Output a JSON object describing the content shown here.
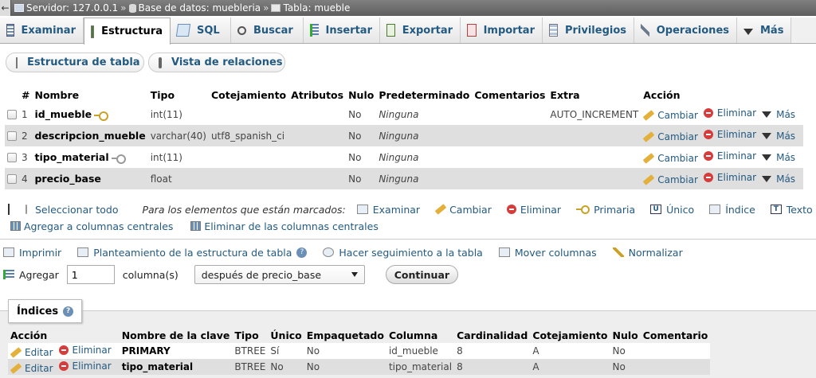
{
  "breadcrumb": {
    "back": "←",
    "server": "Servidor: 127.0.0.1",
    "database": "Base de datos: muebleria",
    "table": "Tabla: mueble",
    "sep": "»"
  },
  "tabs": [
    {
      "label": "Examinar",
      "icon": "browse-icon"
    },
    {
      "label": "Estructura",
      "icon": "structure-icon"
    },
    {
      "label": "SQL",
      "icon": "sql-icon"
    },
    {
      "label": "Buscar",
      "icon": "search-icon"
    },
    {
      "label": "Insertar",
      "icon": "insert-icon"
    },
    {
      "label": "Exportar",
      "icon": "export-icon"
    },
    {
      "label": "Importar",
      "icon": "import-icon"
    },
    {
      "label": "Privilegios",
      "icon": "privileges-icon"
    },
    {
      "label": "Operaciones",
      "icon": "wrench-icon"
    },
    {
      "label": "Más",
      "icon": "chevron-down-icon"
    }
  ],
  "subtabs": {
    "structure": "Estructura de tabla",
    "relations": "Vista de relaciones"
  },
  "columns_header": [
    "#",
    "Nombre",
    "Tipo",
    "Cotejamiento",
    "Atributos",
    "Nulo",
    "Predeterminado",
    "Comentarios",
    "Extra",
    "Acción"
  ],
  "columns": [
    {
      "num": "1",
      "name": "id_mueble",
      "type": "int(11)",
      "collation": "",
      "attributes": "",
      "null": "No",
      "default": "Ninguna",
      "comments": "",
      "extra": "AUTO_INCREMENT"
    },
    {
      "num": "2",
      "name": "descripcion_mueble",
      "type": "varchar(40)",
      "collation": "utf8_spanish_ci",
      "attributes": "",
      "null": "No",
      "default": "Ninguna",
      "comments": "",
      "extra": ""
    },
    {
      "num": "3",
      "name": "tipo_material",
      "type": "int(11)",
      "collation": "",
      "attributes": "",
      "null": "No",
      "default": "Ninguna",
      "comments": "",
      "extra": ""
    },
    {
      "num": "4",
      "name": "precio_base",
      "type": "float",
      "collation": "",
      "attributes": "",
      "null": "No",
      "default": "Ninguna",
      "comments": "",
      "extra": ""
    }
  ],
  "row_actions": {
    "change": "Cambiar",
    "drop": "Eliminar",
    "more": "Más"
  },
  "bulk": {
    "select_all": "Seleccionar todo",
    "with_selected": "Para los elementos que están marcados:",
    "options": [
      "Examinar",
      "Cambiar",
      "Eliminar",
      "Primaria",
      "Único",
      "Índice",
      "Texto"
    ],
    "add_central": "Agregar a columnas centrales",
    "remove_central": "Eliminar de las columnas centrales"
  },
  "links": {
    "print": "Imprimir",
    "propose": "Planteamiento de la estructura de tabla",
    "track": "Hacer seguimiento a la tabla",
    "move": "Mover columnas",
    "normalize": "Normalizar"
  },
  "add_columns": {
    "label": "Agregar",
    "value": "1",
    "unit": "columna(s)",
    "position": "después de precio_base",
    "submit": "Continuar"
  },
  "indexes": {
    "title": "Índices",
    "header": [
      "Acción",
      "Nombre de la clave",
      "Tipo",
      "Único",
      "Empaquetado",
      "Columna",
      "Cardinalidad",
      "Cotejamiento",
      "Nulo",
      "Comentario"
    ],
    "actions": {
      "edit": "Editar",
      "drop": "Eliminar"
    },
    "rows": [
      {
        "key": "PRIMARY",
        "type": "BTREE",
        "unique": "Sí",
        "packed": "No",
        "column": "id_mueble",
        "cardinality": "8",
        "collation": "A",
        "null": "No",
        "comment": ""
      },
      {
        "key": "tipo_material",
        "type": "BTREE",
        "unique": "No",
        "packed": "No",
        "column": "tipo_material",
        "cardinality": "8",
        "collation": "A",
        "null": "No",
        "comment": ""
      }
    ]
  }
}
